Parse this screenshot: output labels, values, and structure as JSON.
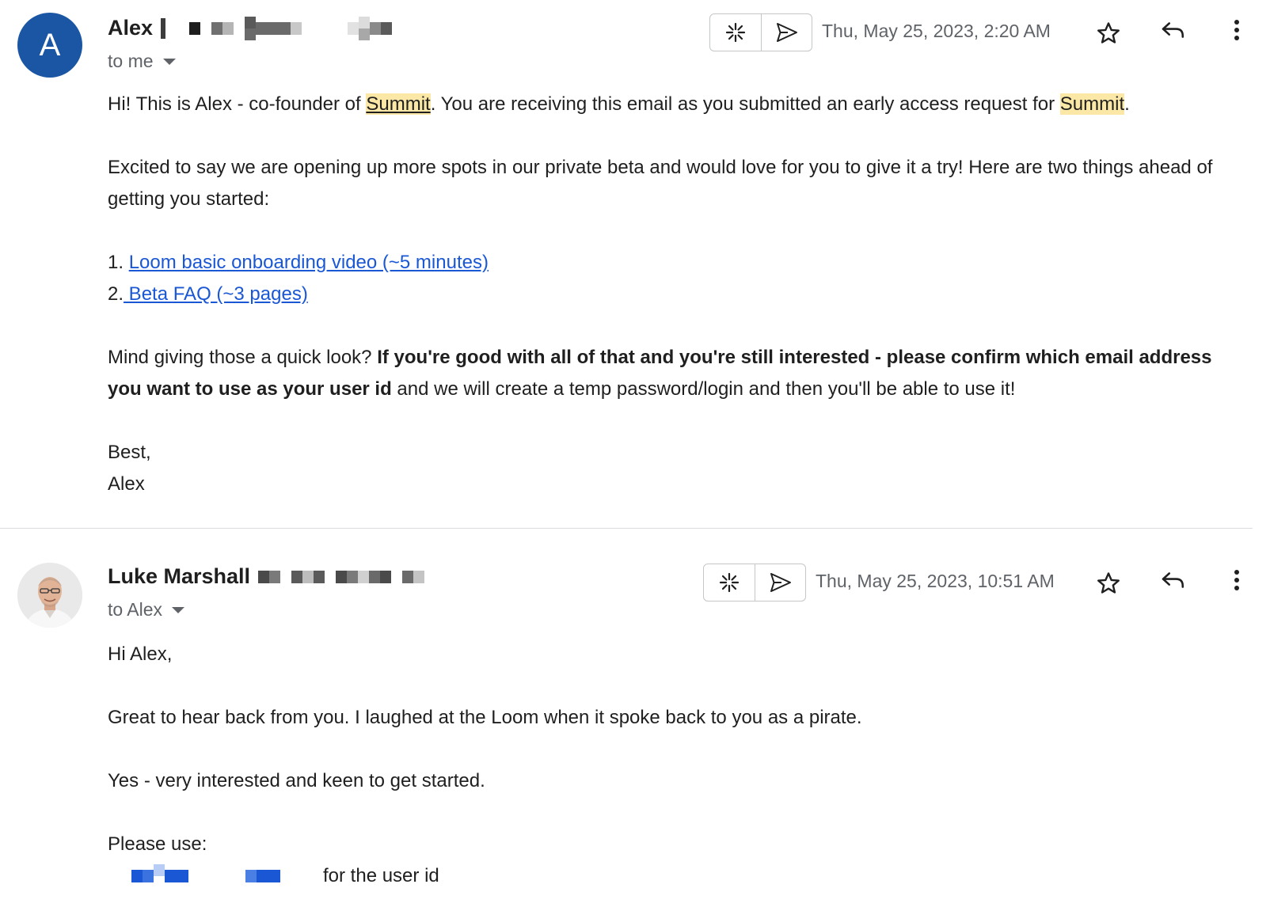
{
  "messages": [
    {
      "avatar_letter": "A",
      "sender_name": "Alex",
      "recipient": "to me",
      "timestamp": "Thu, May 25, 2023, 2:20 AM",
      "body": {
        "p1_a": "Hi! This is Alex - co-founder of ",
        "p1_summit1": "Summit",
        "p1_b": ". You are receiving this email as you submitted an early access request for ",
        "p1_summit2": "Summit",
        "p1_c": ".",
        "p2": "Excited to say we are opening up more spots in our private beta and would love for you to give it a try! Here are two things ahead of getting you started:",
        "list": [
          {
            "num": "1. ",
            "link": "Loom basic onboarding video (~5 minutes)"
          },
          {
            "num": "2.",
            "link": " Beta FAQ (~3 pages)"
          }
        ],
        "p3_a": "Mind giving those a quick look? ",
        "p3_bold": "If you're good with all of that and you're still interested - please confirm which email address you want to use as your user id",
        "p3_b": " and we will create a temp password/login and then you'll be able to use it!",
        "signoff": "Best,",
        "signature": "Alex"
      }
    },
    {
      "sender_name": "Luke Marshall",
      "recipient": "to Alex",
      "timestamp": "Thu, May 25, 2023, 10:51 AM",
      "body": {
        "greeting": "Hi Alex,",
        "p1": "Great to hear back from you. I laughed at the Loom when it spoke back to you as a pirate.",
        "p2": "Yes - very interested and keen to get started.",
        "p3": "Please use:",
        "p4_suffix": "for the user id"
      }
    }
  ],
  "colors": {
    "avatar_bg": "#1a56a3",
    "highlight": "#fce8a6",
    "link": "#1a57d4",
    "divider": "#dadce0"
  },
  "icons": [
    "ai-sparkle-icon",
    "send-icon",
    "star-icon",
    "reply-icon",
    "more-vert-icon",
    "chevron-down-icon"
  ]
}
